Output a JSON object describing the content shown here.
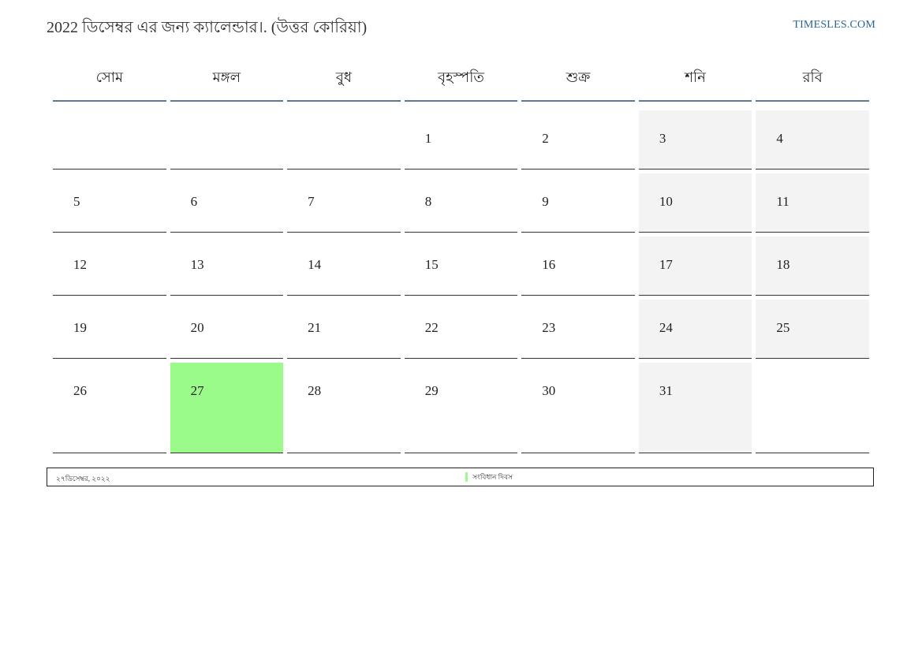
{
  "header": {
    "title": "2022 ডিসেম্বর এর জন্য ক্যালেন্ডার।. (উত্তর কোরিয়া)",
    "site": "TIMESLES.COM"
  },
  "weekdays": [
    "সোম",
    "মঙ্গল",
    "বুধ",
    "বৃহস্পতি",
    "শুক্র",
    "শনি",
    "রবি"
  ],
  "weeks": [
    [
      "",
      "",
      "",
      "1",
      "2",
      "3",
      "4"
    ],
    [
      "5",
      "6",
      "7",
      "8",
      "9",
      "10",
      "11"
    ],
    [
      "12",
      "13",
      "14",
      "15",
      "16",
      "17",
      "18"
    ],
    [
      "19",
      "20",
      "21",
      "22",
      "23",
      "24",
      "25"
    ],
    [
      "26",
      "27",
      "28",
      "29",
      "30",
      "31",
      ""
    ]
  ],
  "highlight": {
    "day": "27",
    "color": "#9afa8a"
  },
  "colors": {
    "weekend_bg": "#f3f3f3",
    "header_rule": "#5b7a9a",
    "link": "#2a6496"
  },
  "legend": {
    "date": "২৭ডিসেম্বর, ২০২২",
    "holiday": "সংবিধান দিবস"
  }
}
